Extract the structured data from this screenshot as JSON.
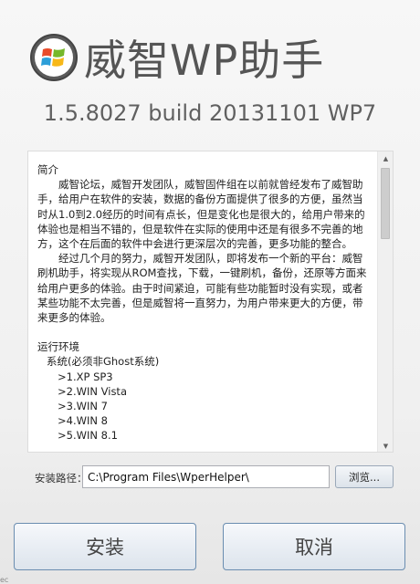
{
  "app": {
    "title": "威智WP助手",
    "version": "1.5.8027 build 20131101 WP7"
  },
  "intro": {
    "heading": "简介",
    "paragraph1": "威智论坛，威智开发团队，威智固件组在以前就曾经发布了威智助手，给用户在软件的安装，数据的备份方面提供了很多的方便，虽然当时从1.0到2.0经历的时间有点长，但是变化也是很大的，给用户带来的体验也是相当不错的，但是软件在实际的使用中还是有很多不完善的地方，这个在后面的软件中会进行更深层次的完善，更多功能的整合。",
    "paragraph2": "经过几个月的努力，威智开发团队，即将发布一个新的平台：威智刷机助手，将实现从ROM查找，下载，一键刷机，备份，还原等方面来给用户更多的体验。由于时间紧迫，可能有些功能暂时没有实现，或者某些功能不太完善，但是威智将一直努力，为用户带来更大的方便，带来更多的体验。",
    "env_heading": "运行环境",
    "system_heading": "系统(必须非Ghost系统)",
    "systems": [
      ">1.XP SP3",
      ">2.WIN Vista",
      ">3.WIN 7",
      ">4.WIN 8",
      ">5.WIN 8.1"
    ]
  },
  "path": {
    "label": "安装路径：",
    "value": "C:\\Program Files\\WperHelper\\",
    "browse_label": "浏览..."
  },
  "buttons": {
    "install": "安装",
    "cancel": "取消"
  },
  "corner_text": "ec",
  "icons": {
    "logo": "windows-logo-icon",
    "scroll_up": "scroll-up-icon",
    "scroll_down": "scroll-down-icon"
  },
  "colors": {
    "logo_red": "#e84b2a",
    "logo_green": "#76b82a",
    "logo_blue": "#2d9fd9",
    "logo_yellow": "#f7b819"
  }
}
